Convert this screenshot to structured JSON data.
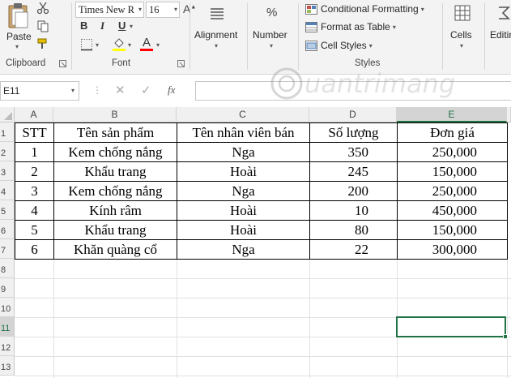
{
  "ribbon": {
    "clipboard": {
      "paste_label": "Paste",
      "group_label": "Clipboard"
    },
    "font": {
      "font_name": "Times New R",
      "font_size": "16",
      "bold": "B",
      "italic": "I",
      "underline": "U",
      "font_color_letter": "A",
      "group_label": "Font",
      "fill_color": "#FFFF00",
      "font_color": "#FF0000"
    },
    "alignment": {
      "label": "Alignment"
    },
    "number": {
      "label": "Number",
      "symbol": "%"
    },
    "styles": {
      "conditional_formatting": "Conditional Formatting",
      "format_as_table": "Format as Table",
      "cell_styles": "Cell Styles",
      "group_label": "Styles"
    },
    "cells": {
      "label": "Cells"
    },
    "editing": {
      "label": "Editin"
    }
  },
  "formula_bar": {
    "name_box": "E11",
    "fx_label": "fx",
    "formula": ""
  },
  "sheet": {
    "columns": [
      "A",
      "B",
      "C",
      "D",
      "E"
    ],
    "rows": [
      "1",
      "2",
      "3",
      "4",
      "5",
      "6",
      "7",
      "8",
      "9",
      "10",
      "11",
      "12",
      "13"
    ],
    "table": {
      "headers": [
        "STT",
        "Tên sản phẩm",
        "Tên nhân viên bán",
        "Số lượng",
        "Đơn giá"
      ],
      "rows": [
        [
          "1",
          "Kem chống nắng",
          "Nga",
          "350",
          "250,000"
        ],
        [
          "2",
          "Khẩu trang",
          "Hoài",
          "245",
          "150,000"
        ],
        [
          "3",
          "Kem chống nắng",
          "Nga",
          "200",
          "250,000"
        ],
        [
          "4",
          "Kính râm",
          "Hoài",
          "10",
          "450,000"
        ],
        [
          "5",
          "Khẩu trang",
          "Hoài",
          "80",
          "150,000"
        ],
        [
          "6",
          "Khăn quàng cổ",
          "Nga",
          "22",
          "300,000"
        ]
      ]
    },
    "active_cell": "E11",
    "accent_color": "#217346"
  }
}
